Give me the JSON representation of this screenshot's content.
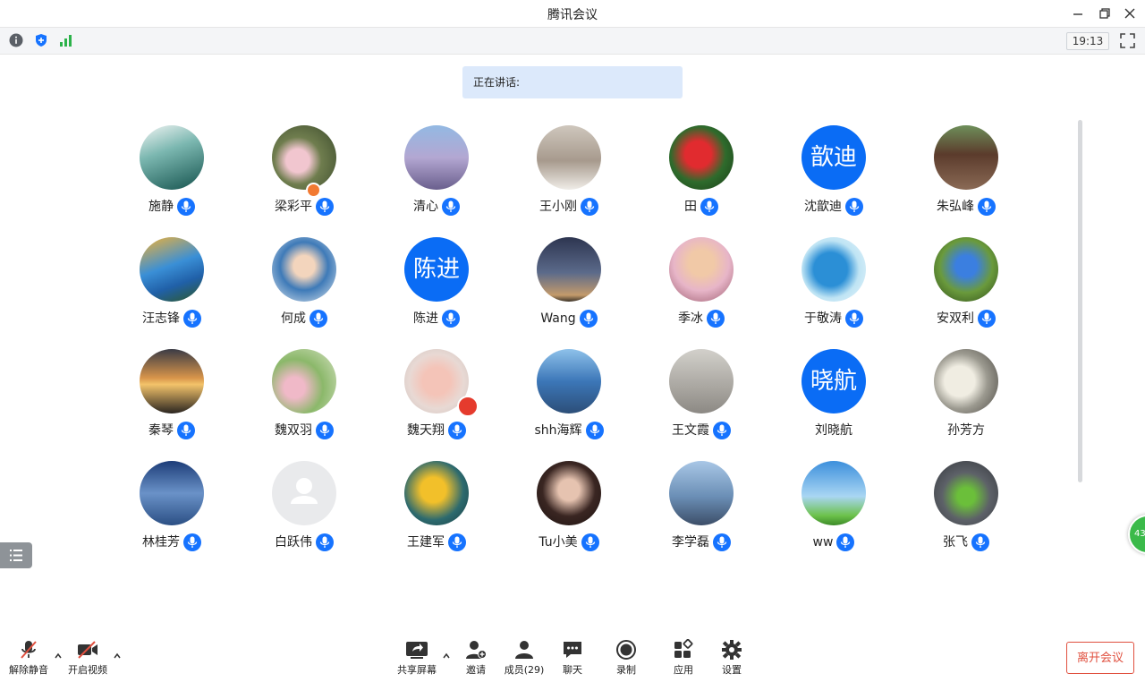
{
  "window": {
    "title": "腾讯会议"
  },
  "topbar": {
    "time": "19:13"
  },
  "speaking": {
    "label": "正在讲话:"
  },
  "participants": [
    {
      "name": "施静",
      "avatar": "photo",
      "bg": "linear-gradient(160deg,#f2f5f4 0%,#7bb7b0 40%,#15534e 100%)"
    },
    {
      "name": "梁彩平",
      "avatar": "photo",
      "bg": "radial-gradient(circle at 40% 55%,#f1c6cf 0 22%,#6f7d4e 45%,#3b4a2c 100%)",
      "badge": true
    },
    {
      "name": "清心",
      "avatar": "photo",
      "bg": "linear-gradient(180deg,#93b9e3 0%,#b3a7d2 50%,#6a5f8d 100%)"
    },
    {
      "name": "王小刚",
      "avatar": "photo",
      "bg": "linear-gradient(180deg,#cfc7bd 0%,#a79a8d 55%,#f0ede8 100%)"
    },
    {
      "name": "田",
      "avatar": "photo",
      "bg": "radial-gradient(circle at 45% 45%,#e12b2f 0 26%,#2e6b2c 55%,#1a3a16 100%)"
    },
    {
      "name": "沈歆迪",
      "avatar": "text",
      "text": "歆迪"
    },
    {
      "name": "朱弘峰",
      "avatar": "photo",
      "bg": "linear-gradient(180deg,#6e8f5a 0%,#5b3b2c 45%,#8a6a55 100%)"
    },
    {
      "name": "汪志锋",
      "avatar": "photo",
      "bg": "linear-gradient(160deg,#f2b235 0%,#3a8fd6 45%,#2060a8 70%,#2f5a26 100%)"
    },
    {
      "name": "何成",
      "avatar": "photo",
      "bg": "radial-gradient(circle at 50% 45%,#f3d5bd 0 22%,#3e7ab8 50%,#dfe7ee 100%)"
    },
    {
      "name": "陈进",
      "avatar": "text",
      "text": "陈进"
    },
    {
      "name": "Wang",
      "avatar": "photo",
      "bg": "linear-gradient(180deg,#2d3550 0%,#5b6a8a 55%,#c39a6b 90%,#3a3228 100%)"
    },
    {
      "name": "季冰",
      "avatar": "photo",
      "bg": "radial-gradient(circle at 50% 40%,#f1c9a7 0 25%,#e7b5c8 55%,#9a5a6c 100%)"
    },
    {
      "name": "于敬涛",
      "avatar": "photo",
      "bg": "radial-gradient(circle at 45% 50%,#2b8fd6 0 35%,#bfe4f4 60%,#e8f5fb 100%)"
    },
    {
      "name": "安双利",
      "avatar": "photo",
      "bg": "radial-gradient(circle at 50% 45%,#3b7fe0 0 22%,#6a9a3c 55%,#2d4a18 100%)"
    },
    {
      "name": "秦琴",
      "avatar": "photo",
      "bg": "linear-gradient(180deg,#3a3b45 0%,#d8954a 45%,#f3c36a 55%,#2a2520 100%)"
    },
    {
      "name": "魏双羽",
      "avatar": "photo",
      "bg": "radial-gradient(circle at 35% 60%,#f0b9c8 0 18%,#8bb86a 50%,#d7e2c4 100%)"
    },
    {
      "name": "魏天翔",
      "avatar": "photo",
      "bg": "radial-gradient(circle at 50% 50%,#f4c4b8 0 30%,#e8d9d4 60%,#cfc3be 100%)",
      "flag": true
    },
    {
      "name": "shh海辉",
      "avatar": "photo",
      "bg": "linear-gradient(180deg,#8ec1ea 0%,#3c77b8 50%,#2c4e78 100%)"
    },
    {
      "name": "王文霞",
      "avatar": "photo",
      "bg": "linear-gradient(180deg,#d2d0cb 0%,#a9a6a0 60%,#8c8984 100%)"
    },
    {
      "name": "刘晓航",
      "avatar": "text",
      "text": "晓航"
    },
    {
      "name": "孙芳方",
      "avatar": "photo",
      "bg": "radial-gradient(circle at 40% 50%,#f0ede2 0 30%,#9c9a90 55%,#4d4a44 100%)"
    },
    {
      "name": "林桂芳",
      "avatar": "photo",
      "bg": "linear-gradient(180deg,#1d3d78 0%,#6a92c8 50%,#2b4f84 100%)"
    },
    {
      "name": "白跃伟",
      "avatar": "default"
    },
    {
      "name": "王建军",
      "avatar": "photo",
      "bg": "radial-gradient(circle at 45% 45%,#f2c02a 0 25%,#2d6a6e 60%,#173a3f 100%)"
    },
    {
      "name": "Tu小美",
      "avatar": "photo",
      "bg": "radial-gradient(circle at 50% 45%,#e6c3b0 0 22%,#3a2622 55%,#1c1210 100%)"
    },
    {
      "name": "李学磊",
      "avatar": "photo",
      "bg": "linear-gradient(180deg,#a9c7e6 0%,#6b8fb6 55%,#3c4e68 100%)"
    },
    {
      "name": "ww",
      "avatar": "photo",
      "bg": "linear-gradient(180deg,#3c8fdc 0%,#a9d6f3 55%,#6cc24a 85%,#3c8a28 100%)"
    },
    {
      "name": "张飞",
      "avatar": "photo",
      "bg": "radial-gradient(circle at 50% 55%,#6bbf3a 0 18%,#5d6168 50%,#33363b 100%)"
    }
  ],
  "bottombar": {
    "unmute_label": "解除静音",
    "video_label": "开启视频",
    "share_label": "共享屏幕",
    "invite_label": "邀请",
    "members_label": "成员(29)",
    "chat_label": "聊天",
    "record_label": "录制",
    "apps_label": "应用",
    "settings_label": "设置",
    "leave_label": "离开会议"
  },
  "floatball": {
    "count": "43"
  },
  "colors": {
    "accent": "#1673ff",
    "danger": "#e0503f"
  }
}
